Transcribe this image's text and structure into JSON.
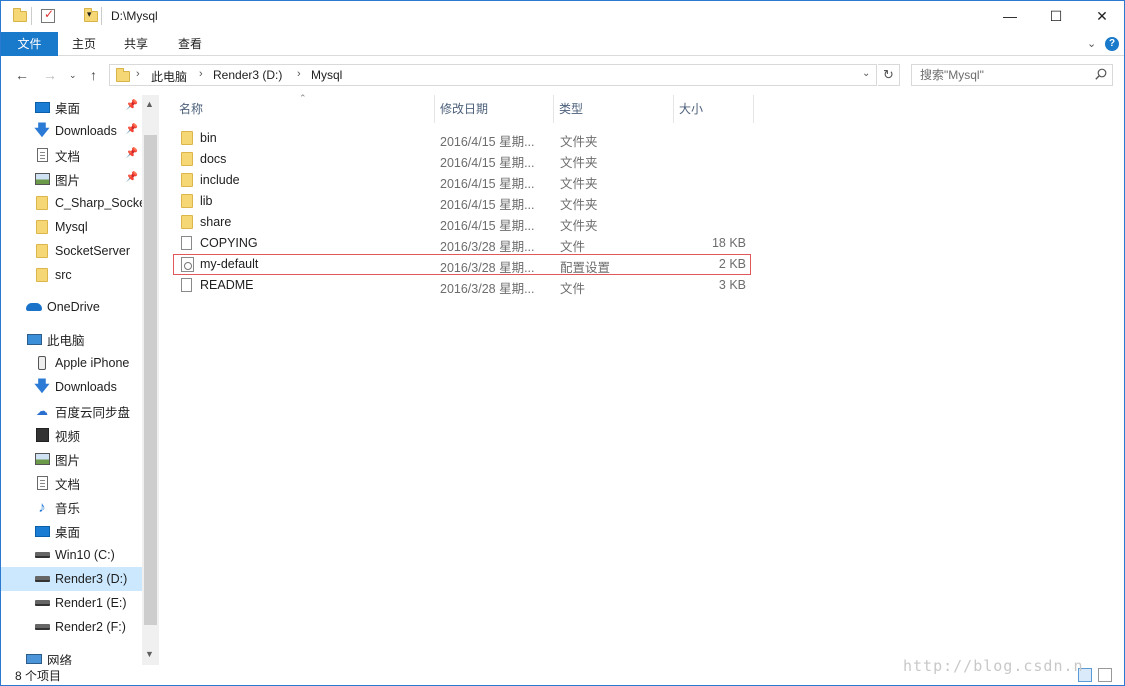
{
  "window": {
    "title": "D:\\Mysql",
    "controls": {
      "minimize": "—",
      "maximize": "☐",
      "close": "✕"
    }
  },
  "ribbon": {
    "tabs": [
      "文件",
      "主页",
      "共享",
      "查看"
    ],
    "help": "?"
  },
  "address": {
    "crumbs": [
      "此电脑",
      "Render3 (D:)",
      "Mysql"
    ],
    "search_placeholder": "搜索\"Mysql\""
  },
  "nav": {
    "quick_access": [
      {
        "label": "桌面",
        "icon": "desktop-icon",
        "pinned": true
      },
      {
        "label": "Downloads",
        "icon": "download-icon",
        "pinned": true
      },
      {
        "label": "文档",
        "icon": "document-icon",
        "pinned": true
      },
      {
        "label": "图片",
        "icon": "picture-icon",
        "pinned": true
      },
      {
        "label": "C_Sharp_Socke",
        "icon": "folder-icon",
        "pinned": false
      },
      {
        "label": "Mysql",
        "icon": "folder-icon",
        "pinned": false
      },
      {
        "label": "SocketServer",
        "icon": "folder-icon",
        "pinned": false
      },
      {
        "label": "src",
        "icon": "folder-icon",
        "pinned": false
      }
    ],
    "onedrive": "OneDrive",
    "this_pc": "此电脑",
    "pc_items": [
      {
        "label": "Apple iPhone",
        "icon": "phone-icon"
      },
      {
        "label": "Downloads",
        "icon": "download-icon"
      },
      {
        "label": "百度云同步盘",
        "icon": "baidu-cloud-icon"
      },
      {
        "label": "视频",
        "icon": "video-icon"
      },
      {
        "label": "图片",
        "icon": "picture-icon"
      },
      {
        "label": "文档",
        "icon": "document-icon"
      },
      {
        "label": "音乐",
        "icon": "music-icon"
      },
      {
        "label": "桌面",
        "icon": "desktop-icon"
      },
      {
        "label": "Win10 (C:)",
        "icon": "system-drive-icon"
      },
      {
        "label": "Render3 (D:)",
        "icon": "drive-icon",
        "selected": true
      },
      {
        "label": "Render1 (E:)",
        "icon": "drive-icon"
      },
      {
        "label": "Render2 (F:)",
        "icon": "drive-icon"
      }
    ],
    "network": "网络"
  },
  "columns": {
    "name": "名称",
    "date": "修改日期",
    "type": "类型",
    "size": "大小"
  },
  "files": [
    {
      "name": "bin",
      "date": "2016/4/15 星期...",
      "type": "文件夹",
      "size": "",
      "kind": "folder"
    },
    {
      "name": "docs",
      "date": "2016/4/15 星期...",
      "type": "文件夹",
      "size": "",
      "kind": "folder"
    },
    {
      "name": "include",
      "date": "2016/4/15 星期...",
      "type": "文件夹",
      "size": "",
      "kind": "folder"
    },
    {
      "name": "lib",
      "date": "2016/4/15 星期...",
      "type": "文件夹",
      "size": "",
      "kind": "folder"
    },
    {
      "name": "share",
      "date": "2016/4/15 星期...",
      "type": "文件夹",
      "size": "",
      "kind": "folder"
    },
    {
      "name": "COPYING",
      "date": "2016/3/28 星期...",
      "type": "文件",
      "size": "18 KB",
      "kind": "file"
    },
    {
      "name": "my-default",
      "date": "2016/3/28 星期...",
      "type": "配置设置",
      "size": "2 KB",
      "kind": "config",
      "highlighted": true
    },
    {
      "name": "README",
      "date": "2016/3/28 星期...",
      "type": "文件",
      "size": "3 KB",
      "kind": "file"
    }
  ],
  "status": {
    "count": "8 个项目"
  },
  "watermark": "http://blog.csdn.n"
}
